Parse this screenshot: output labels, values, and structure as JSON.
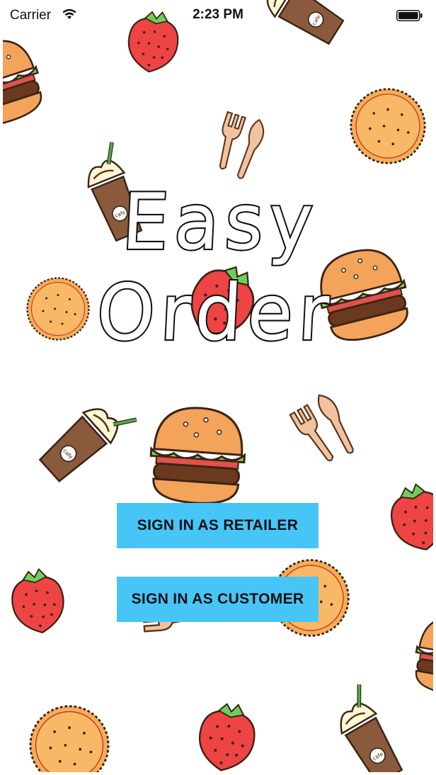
{
  "status_bar": {
    "carrier": "Carrier",
    "time": "2:23 PM"
  },
  "app": {
    "title": "Easy Order"
  },
  "buttons": {
    "retailer": "SIGN IN AS RETAILER",
    "customer": "SIGN IN AS CUSTOMER"
  },
  "colors": {
    "button_bg": "#47c5f7",
    "button_text": "#111111",
    "title_outline": "#111111",
    "background": "#ffffff"
  },
  "background": {
    "pattern": "doodle-food-illustrations",
    "items": [
      "burger",
      "strawberry",
      "iced-coffee-cup",
      "cookie",
      "fork-knife"
    ],
    "cup_label": "cafe"
  }
}
